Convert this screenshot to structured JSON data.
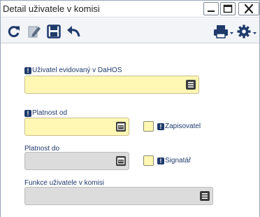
{
  "window": {
    "title": "Detail uživatele v komisi"
  },
  "toolbar": {
    "icons": [
      "refresh-icon",
      "edit-icon",
      "save-icon",
      "undo-icon",
      "print-icon",
      "settings-icon"
    ]
  },
  "form": {
    "user_label": "Uživatel evidovaný v DaHOS",
    "user_value": "",
    "valid_from_label": "Platnost od",
    "valid_from_value": "",
    "recorder_label": "Zapisovatel",
    "valid_to_label": "Platnost do",
    "valid_to_value": "",
    "signatory_label": "Signatář",
    "function_label": "Funkce uživatele v komisi",
    "function_value": ""
  },
  "colors": {
    "required_field": "#fff7b3",
    "disabled_field": "#dcdcdc",
    "label_text": "#1f3a6b"
  }
}
